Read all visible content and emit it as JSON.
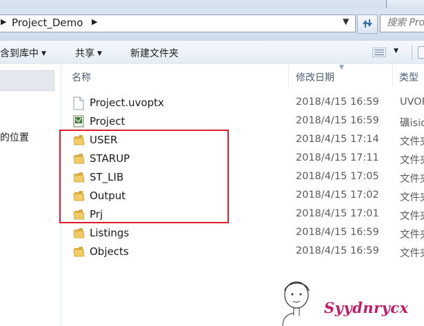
{
  "address_bar": {
    "path_label": "Project_Demo"
  },
  "search": {
    "placeholder": "搜索 Pro"
  },
  "toolbar": {
    "include_label": "含到库中",
    "share_label": "共享",
    "new_folder_label": "新建文件夹"
  },
  "navpane": {
    "location_text": "的位置"
  },
  "columns": {
    "name": "名称",
    "date": "修改日期",
    "type": "类型"
  },
  "files": [
    {
      "name": "Project.uvoptx",
      "date": "2018/4/15 16:59",
      "type": "UVOP",
      "icon": "document-icon"
    },
    {
      "name": "Project",
      "date": "2018/4/15 16:59",
      "type": "礦isio",
      "icon": "uvision-project-icon"
    },
    {
      "name": "USER",
      "date": "2018/4/15 17:14",
      "type": "文件夹",
      "icon": "folder-icon"
    },
    {
      "name": "STARUP",
      "date": "2018/4/15 17:11",
      "type": "文件夹",
      "icon": "folder-icon"
    },
    {
      "name": "ST_LIB",
      "date": "2018/4/15 17:05",
      "type": "文件夹",
      "icon": "folder-icon"
    },
    {
      "name": "Output",
      "date": "2018/4/15 17:02",
      "type": "文件夹",
      "icon": "folder-icon"
    },
    {
      "name": "Prj",
      "date": "2018/4/15 17:01",
      "type": "文件夹",
      "icon": "folder-icon"
    },
    {
      "name": "Listings",
      "date": "2018/4/15 16:59",
      "type": "文件夹",
      "icon": "folder-icon"
    },
    {
      "name": "Objects",
      "date": "2018/4/15 16:59",
      "type": "文件夹",
      "icon": "folder-icon"
    }
  ],
  "watermark": {
    "text": "Syydnrycx"
  },
  "colors": {
    "highlight_border": "#e01a2a",
    "folder": "#e8c15a",
    "watermark": "#c41a6a"
  }
}
